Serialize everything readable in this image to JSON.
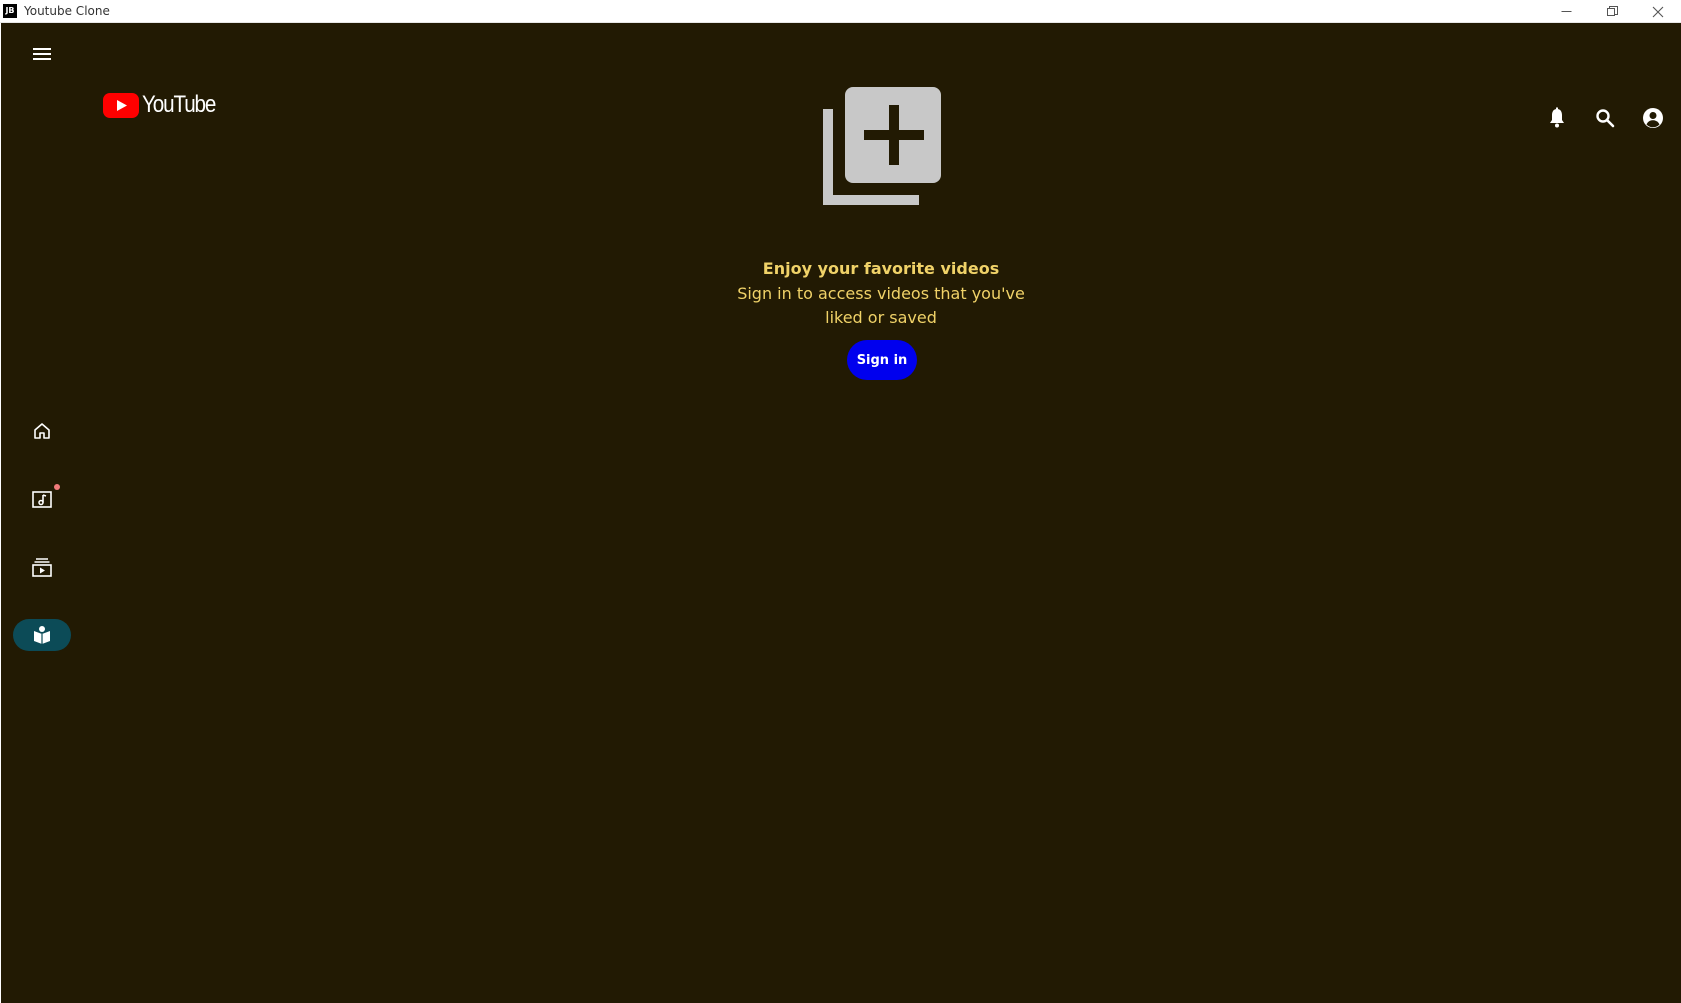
{
  "window": {
    "app_icon_text": "JB",
    "title": "Youtube Clone"
  },
  "header": {
    "logo_text": "YouTube",
    "actions": [
      {
        "name": "notifications-icon"
      },
      {
        "name": "search-icon"
      },
      {
        "name": "account-icon"
      }
    ]
  },
  "main": {
    "title": "Enjoy your favorite videos",
    "subtitle": "Sign in to access videos that you've liked or saved",
    "signin_label": "Sign in"
  },
  "sidebar": {
    "items": [
      {
        "name": "home",
        "active": false
      },
      {
        "name": "shorts",
        "active": false,
        "badge": true
      },
      {
        "name": "subscriptions",
        "active": false
      },
      {
        "name": "library",
        "active": true
      }
    ]
  },
  "colors": {
    "background": "#221a03",
    "text_accent": "#f0d268",
    "signin_button": "#0000ee",
    "active_nav": "#0c4b57",
    "badge": "#f07a7a",
    "logo_red": "#ff0000"
  }
}
